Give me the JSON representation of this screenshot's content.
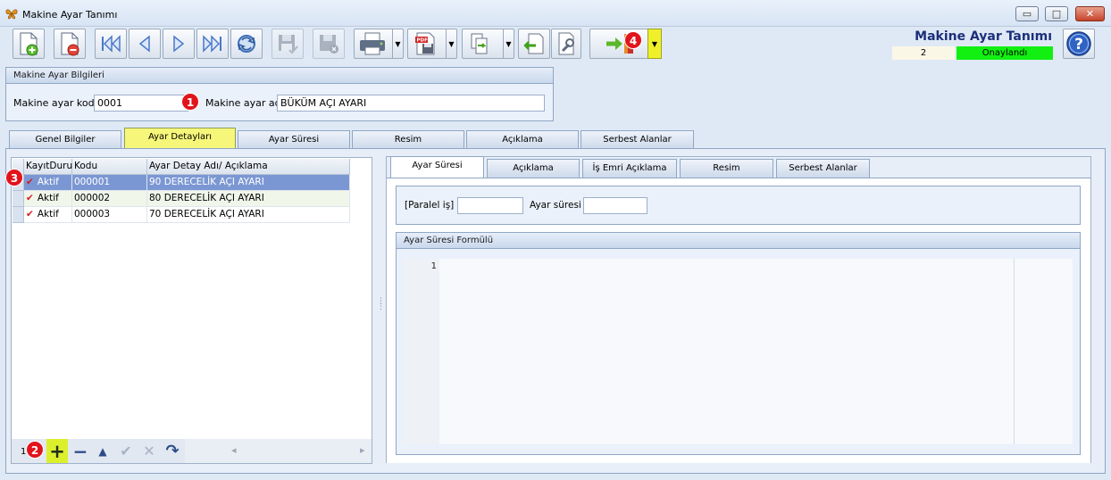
{
  "window": {
    "title": "Makine Ayar Tanımı",
    "minimize": "▭",
    "maximize": "□",
    "close": "✕"
  },
  "toolbar": {
    "buttons": [
      {
        "icon": "new-document-icon"
      },
      {
        "icon": "delete-document-icon"
      },
      {
        "icon": "first-record-icon"
      },
      {
        "icon": "previous-record-icon"
      },
      {
        "icon": "next-record-icon"
      },
      {
        "icon": "last-record-icon"
      },
      {
        "icon": "refresh-icon"
      },
      {
        "icon": "save-icon"
      },
      {
        "icon": "save-delete-icon"
      },
      {
        "icon": "print-icon"
      },
      {
        "icon": "pdf-export-icon"
      },
      {
        "icon": "copy-icon"
      },
      {
        "icon": "import-icon"
      },
      {
        "icon": "settings-tool-icon"
      },
      {
        "icon": "exit-icon"
      }
    ],
    "dropdown_arrow": "▼"
  },
  "header": {
    "title": "Makine Ayar Tanımı",
    "count": "2",
    "status": "Onaylandı",
    "status_color": "#11f011"
  },
  "info_group": {
    "title": "Makine Ayar Bilgileri",
    "code_label": "Makine ayar kodu",
    "code_value": "0001",
    "name_label": "Makine ayar adı",
    "name_value": "BÜKÜM AÇI AYARI"
  },
  "main_tabs": [
    "Genel Bilgiler",
    "Ayar Detayları",
    "Ayar Süresi",
    "Resim",
    "Açıklama",
    "Serbest Alanlar"
  ],
  "main_tab_active": "Ayar Detayları",
  "grid": {
    "columns": [
      "KayıtDurumu",
      "Kodu",
      "Ayar Detay Adı/ Açıklama"
    ],
    "rows": [
      {
        "status": "Aktif",
        "code": "000001",
        "name": "90 DERECELİK AÇI AYARI"
      },
      {
        "status": "Aktif",
        "code": "000002",
        "name": "80 DERECELİK AÇI AYARI"
      },
      {
        "status": "Aktif",
        "code": "000003",
        "name": "70 DERECELİK AÇI AYARI"
      }
    ],
    "check_glyph": "✔",
    "footer_count": "1"
  },
  "navigator": {
    "add": "+",
    "remove": "−",
    "up": "▲",
    "accept": "✔",
    "cancel": "✕",
    "redo": "↷",
    "scroll_left": "◂",
    "scroll_right": "▸"
  },
  "detail_tabs": [
    "Ayar Süresi",
    "Açıklama",
    "İş Emri Açıklama",
    "Resim",
    "Serbest Alanlar"
  ],
  "detail_tab_active": "Ayar Süresi",
  "detail": {
    "parallel_label": "[Paralel iş]",
    "duration_label": "Ayar süresi",
    "formula_title": "Ayar Süresi Formülü",
    "editor_line": "1"
  },
  "callouts": [
    "1",
    "2",
    "3",
    "4"
  ]
}
